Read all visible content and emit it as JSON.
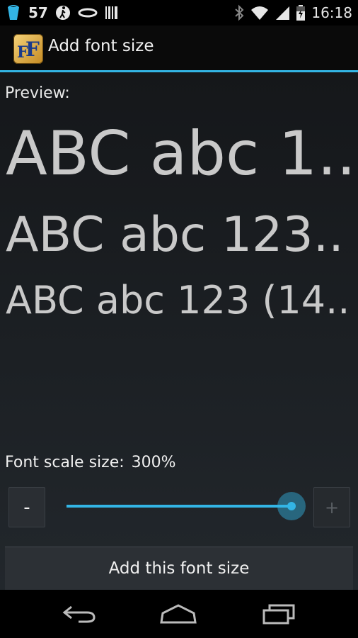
{
  "status_bar": {
    "notification_count": "57",
    "time": "16:18",
    "icons_left": [
      "trash-icon",
      "walker-icon",
      "ring-icon",
      "barcode-icon"
    ],
    "icons_right": [
      "bluetooth-icon",
      "wifi-icon",
      "signal-icon",
      "battery-icon"
    ]
  },
  "action_bar": {
    "title": "Add font size",
    "app_icon_text": "FF"
  },
  "main": {
    "preview_label": "Preview:",
    "previews": [
      "ABC abc 1..",
      "ABC abc 123..",
      "ABC abc 123 (14.."
    ],
    "scale_label": "Font scale size:",
    "scale_value": "300%",
    "minus_label": "-",
    "plus_label": "+",
    "slider_fraction": 1.0,
    "add_button_label": "Add this font size"
  },
  "colors": {
    "accent": "#33b5e5",
    "preview_text": "#c9c9c9",
    "background": "#1c2024"
  },
  "nav_bar": {
    "icons": [
      "back-icon",
      "home-icon",
      "recents-icon"
    ]
  }
}
